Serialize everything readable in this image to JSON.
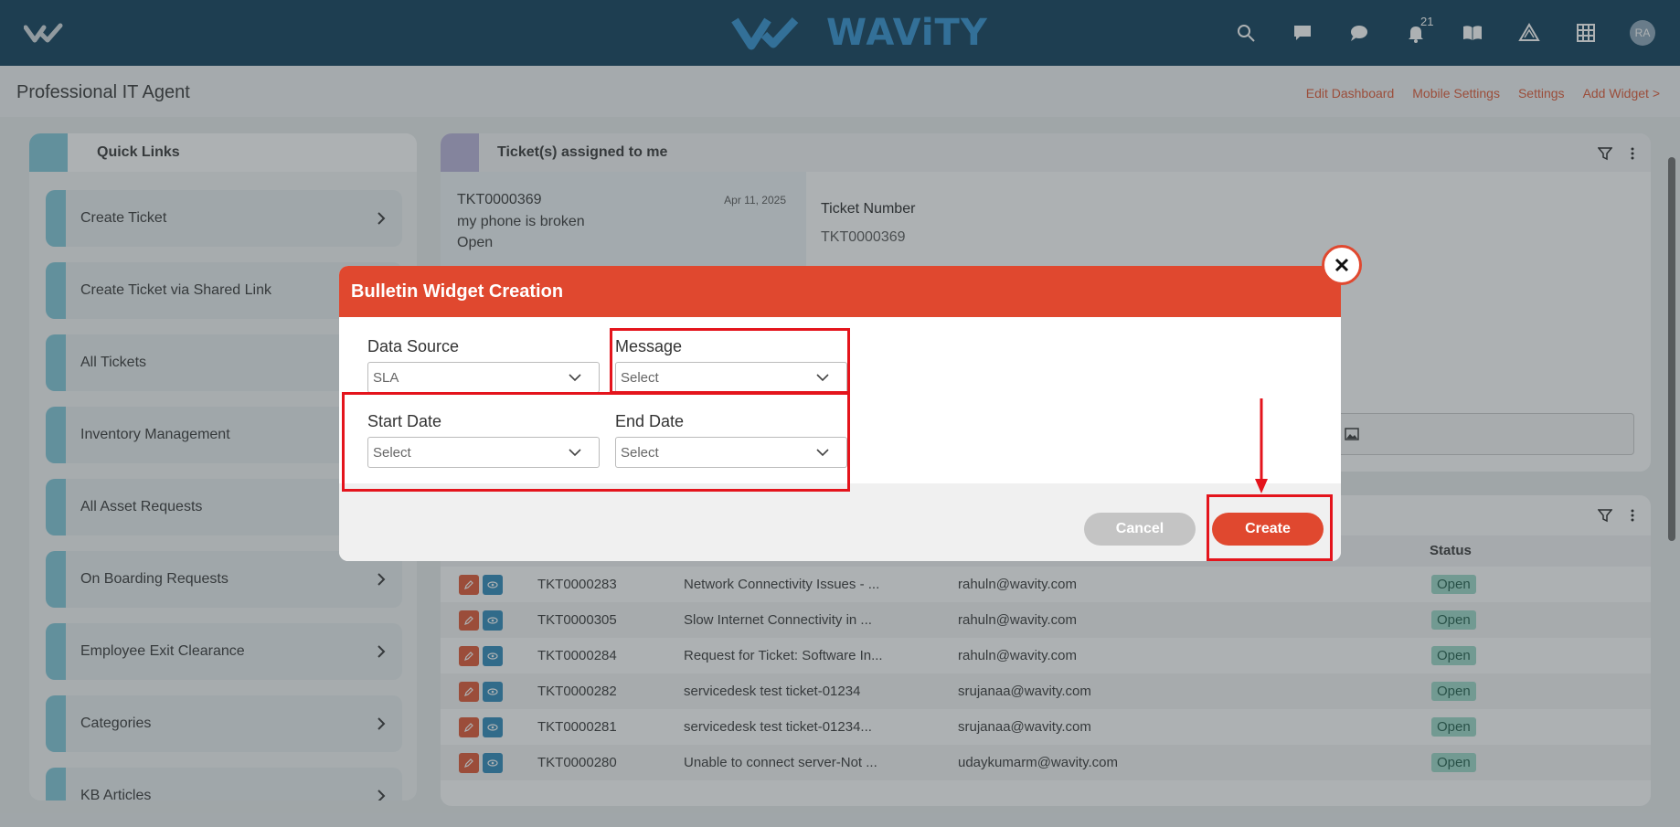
{
  "topbar": {
    "brand": "WAViTY",
    "notification_count": "21",
    "avatar_initials": "RA",
    "icons": [
      "search-icon",
      "chat-icon",
      "comments-icon",
      "bell-icon",
      "book-icon",
      "warning-icon",
      "grid-icon"
    ]
  },
  "subheader": {
    "page_title": "Professional IT Agent",
    "links": [
      "Edit Dashboard",
      "Mobile Settings",
      "Settings",
      "Add Widget >"
    ]
  },
  "quick_links": {
    "title": "Quick Links",
    "items": [
      {
        "label": "Create Ticket"
      },
      {
        "label": "Create Ticket via Shared Link"
      },
      {
        "label": "All Tickets"
      },
      {
        "label": "Inventory Management"
      },
      {
        "label": "All Asset Requests"
      },
      {
        "label": "On Boarding Requests"
      },
      {
        "label": "Employee Exit Clearance"
      },
      {
        "label": "Categories"
      },
      {
        "label": "KB Articles"
      }
    ]
  },
  "assigned_tickets": {
    "title": "Ticket(s) assigned to me",
    "selected": {
      "number": "TKT0000369",
      "date": "Apr 11, 2025",
      "subject": "my phone is broken",
      "status": "Open"
    },
    "detail_label": "Ticket Number",
    "detail_value": "TKT0000369"
  },
  "ticket_table": {
    "status_header": "Status",
    "rows": [
      {
        "number": "TKT0000283",
        "subject": "Network Connectivity Issues - ...",
        "email": "rahuln@wavity.com",
        "status": "Open"
      },
      {
        "number": "TKT0000305",
        "subject": "Slow Internet Connectivity in ...",
        "email": "rahuln@wavity.com",
        "status": "Open"
      },
      {
        "number": "TKT0000284",
        "subject": "Request for Ticket: Software In...",
        "email": "rahuln@wavity.com",
        "status": "Open"
      },
      {
        "number": "TKT0000282",
        "subject": "servicedesk test ticket-01234",
        "email": "srujanaa@wavity.com",
        "status": "Open"
      },
      {
        "number": "TKT0000281",
        "subject": "servicedesk test ticket-01234...",
        "email": "srujanaa@wavity.com",
        "status": "Open"
      },
      {
        "number": "TKT0000280",
        "subject": "Unable to connect server-Not ...",
        "email": "udaykumarm@wavity.com",
        "status": "Open"
      }
    ]
  },
  "modal": {
    "title": "Bulletin Widget Creation",
    "fields": {
      "data_source": {
        "label": "Data Source",
        "value": "SLA"
      },
      "message": {
        "label": "Message",
        "value": "Select"
      },
      "start_date": {
        "label": "Start Date",
        "value": "Select"
      },
      "end_date": {
        "label": "End Date",
        "value": "Select"
      }
    },
    "cancel_label": "Cancel",
    "create_label": "Create"
  },
  "colors": {
    "topbar": "#0a3a56",
    "accent": "#e0482f",
    "brand": "#2d8fd0",
    "annotation": "#e4141c"
  }
}
